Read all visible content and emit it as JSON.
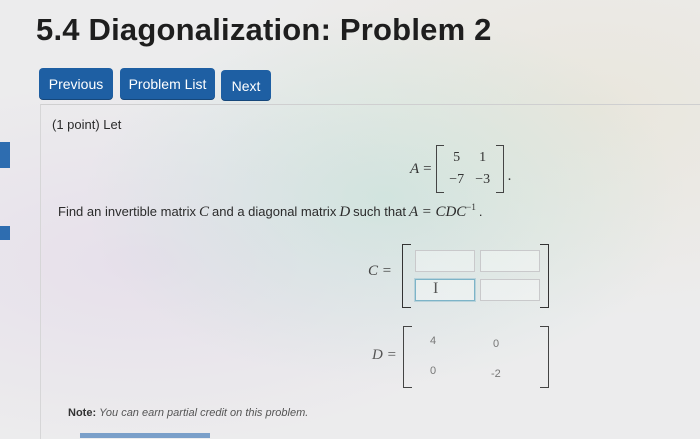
{
  "page": {
    "title": "5.4 Diagonalization: Problem 2"
  },
  "nav": {
    "previous_label": "Previous",
    "problem_list_label": "Problem List",
    "next_label": "Next"
  },
  "problem": {
    "intro": "(1 point) Let",
    "matrix_a": {
      "var": "A",
      "eq": "=",
      "row1": [
        "5",
        "1"
      ],
      "row2": [
        "−7",
        "−3"
      ],
      "period": "."
    },
    "instruction": {
      "t1": "Find an invertible matrix",
      "c": "C",
      "t2": "and a diagonal matrix",
      "d": "D",
      "t3": "such that",
      "eq": "A = CDC",
      "exp": "−1",
      "t4": "."
    },
    "c_answer": {
      "label": "C =",
      "cells": [
        "",
        "",
        "",
        ""
      ],
      "cursor": "I"
    },
    "d_answer": {
      "label": "D =",
      "row1": [
        "4",
        "0"
      ],
      "row2": [
        "0",
        "-2"
      ]
    },
    "note_label": "Note:",
    "note_text": "You can earn partial credit on this problem."
  },
  "colors": {
    "button_blue": "#1e5fa3",
    "title_text": "#1e1e1e"
  }
}
